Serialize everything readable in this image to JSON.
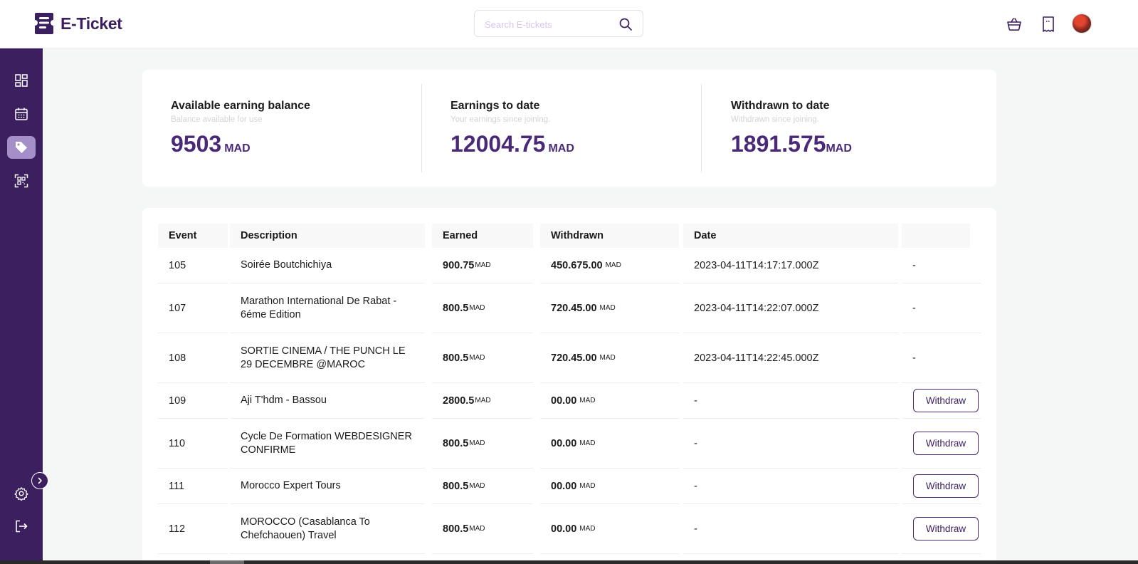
{
  "header": {
    "brand": "E-Ticket",
    "search_placeholder": "Search E-tickets",
    "icons": [
      "basket-icon",
      "ticket-icon",
      "user-avatar"
    ]
  },
  "sidebar": {
    "items": [
      {
        "name": "dashboard-icon",
        "active": false
      },
      {
        "name": "calendar-icon",
        "active": false
      },
      {
        "name": "tag-icon",
        "active": true
      },
      {
        "name": "qr-scan-icon",
        "active": false
      }
    ],
    "bottom_items": [
      "settings-icon",
      "logout-icon"
    ]
  },
  "stats": [
    {
      "title": "Available earning balance",
      "subtitle": "Balance available for use",
      "amount": "9503",
      "currency": "MAD"
    },
    {
      "title": "Earnings to date",
      "subtitle": "Your earnings since joining.",
      "amount": "12004.75",
      "currency": "MAD"
    },
    {
      "title": "Withdrawn to date",
      "subtitle": "Withdrawn since joining.",
      "amount": "1891.575",
      "currency": "MAD"
    }
  ],
  "table": {
    "headers": [
      "Event",
      "Description",
      "Earned",
      "Withdrawn",
      "Date",
      ""
    ],
    "rows": [
      {
        "event": "105",
        "description": "Soirée Boutchichiya",
        "earned": "900.75",
        "earned_cur": "MAD",
        "withdrawn": "450.675.00",
        "withdrawn_cur": "MAD",
        "date": "2023-04-11T14:17:17.000Z",
        "action": "-"
      },
      {
        "event": "107",
        "description": "Marathon International De Rabat - 6éme Edition",
        "earned": "800.5",
        "earned_cur": "MAD",
        "withdrawn": "720.45.00",
        "withdrawn_cur": "MAD",
        "date": "2023-04-11T14:22:07.000Z",
        "action": "-"
      },
      {
        "event": "108",
        "description": "SORTIE CINEMA / THE PUNCH LE 29 DECEMBRE @MAROC",
        "earned": "800.5",
        "earned_cur": "MAD",
        "withdrawn": "720.45.00",
        "withdrawn_cur": "MAD",
        "date": "2023-04-11T14:22:45.000Z",
        "action": "-"
      },
      {
        "event": "109",
        "description": "Aji T'hdm - Bassou",
        "earned": "2800.5",
        "earned_cur": "MAD",
        "withdrawn": "00.00",
        "withdrawn_cur": "MAD",
        "date": "-",
        "action": "Withdraw"
      },
      {
        "event": "110",
        "description": "Cycle De Formation WEBDESIGNER CONFIRME",
        "earned": "800.5",
        "earned_cur": "MAD",
        "withdrawn": "00.00",
        "withdrawn_cur": "MAD",
        "date": "-",
        "action": "Withdraw"
      },
      {
        "event": "111",
        "description": "Morocco Expert Tours",
        "earned": "800.5",
        "earned_cur": "MAD",
        "withdrawn": "00.00",
        "withdrawn_cur": "MAD",
        "date": "-",
        "action": "Withdraw"
      },
      {
        "event": "112",
        "description": "MOROCCO (Casablanca To Chefchaouen) Travel",
        "earned": "800.5",
        "earned_cur": "MAD",
        "withdrawn": "00.00",
        "withdrawn_cur": "MAD",
        "date": "-",
        "action": "Withdraw"
      }
    ]
  },
  "colors": {
    "brand": "#3b1f5e",
    "accent": "#4a2a78",
    "active_sidebar": "#a48fc9"
  }
}
